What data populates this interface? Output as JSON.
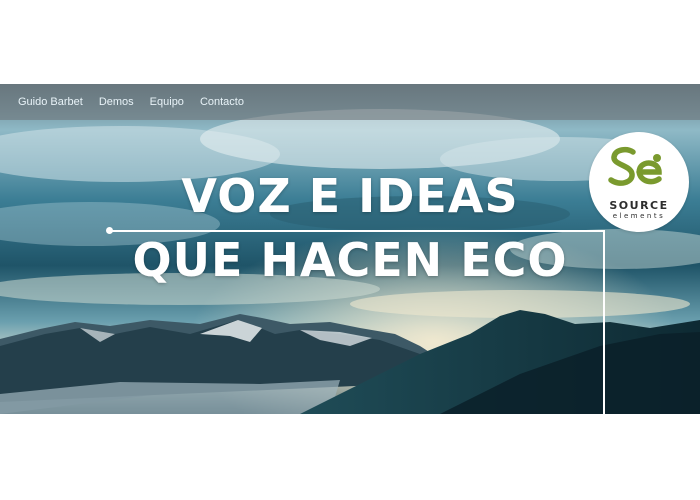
{
  "nav": {
    "items": [
      {
        "label": "Guido Barbet"
      },
      {
        "label": "Demos"
      },
      {
        "label": "Equipo"
      },
      {
        "label": "Contacto"
      }
    ]
  },
  "hero": {
    "headline_line1": "VOZ E IDEAS",
    "headline_line2": "QUE HACEN ECO"
  },
  "logo": {
    "monogram": "Se",
    "word1": "SOURCE",
    "word2": "elements",
    "accent_color": "#7a9a2e"
  },
  "colors": {
    "sky_top": "#1d4e60",
    "sky_mid": "#6fb4c8",
    "horizon": "#e9e2c9",
    "mountain_dark": "#12303a",
    "text": "#ffffff"
  }
}
